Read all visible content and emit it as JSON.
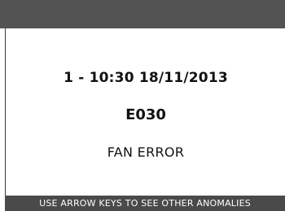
{
  "anomaly": {
    "header": "1 - 10:30 18/11/2013",
    "code": "E030",
    "description": "FAN ERROR"
  },
  "footer": {
    "hint": "USE ARROW KEYS TO SEE OTHER ANOMALIES"
  },
  "colors": {
    "top_bar": "#535353",
    "bottom_bar": "#4a4a4a",
    "background": "#ffffff",
    "text": "#111111",
    "footer_text": "#ffffff"
  }
}
